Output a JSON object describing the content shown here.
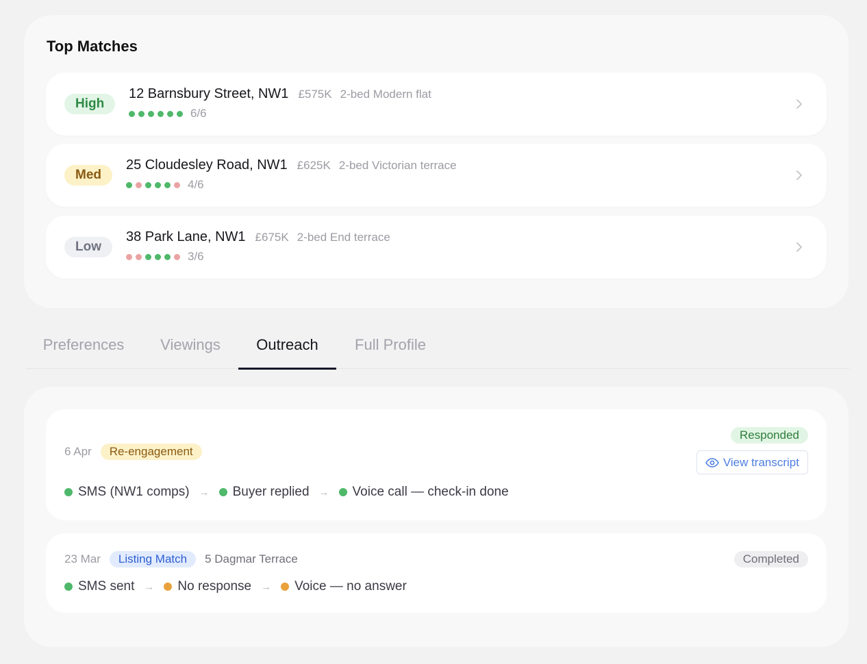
{
  "top_matches": {
    "title": "Top Matches",
    "items": [
      {
        "badge": "High",
        "address": "12 Barnsbury Street, NW1",
        "price": "£575K",
        "type": "2-bed Modern flat",
        "score": "6/6",
        "dots": [
          "green",
          "green",
          "green",
          "green",
          "green",
          "green"
        ]
      },
      {
        "badge": "Med",
        "address": "25 Cloudesley Road, NW1",
        "price": "£625K",
        "type": "2-bed Victorian terrace",
        "score": "4/6",
        "dots": [
          "green",
          "red",
          "green",
          "green",
          "green",
          "red"
        ]
      },
      {
        "badge": "Low",
        "address": "38 Park Lane, NW1",
        "price": "£675K",
        "type": "2-bed End terrace",
        "score": "3/6",
        "dots": [
          "red",
          "red",
          "green",
          "green",
          "green",
          "red"
        ]
      }
    ]
  },
  "tabs": [
    "Preferences",
    "Viewings",
    "Outreach",
    "Full Profile"
  ],
  "active_tab": "Outreach",
  "outreach": [
    {
      "date": "6 Apr",
      "tag": "Re-engagement",
      "status": "Responded",
      "action": "View transcript",
      "steps": [
        {
          "label": "SMS (NW1 comps)",
          "dot": "green"
        },
        {
          "label": "Buyer replied",
          "dot": "green"
        },
        {
          "label": "Voice call — check-in done",
          "dot": "green"
        }
      ]
    },
    {
      "date": "23 Mar",
      "tag": "Listing Match",
      "property": "5 Dagmar Terrace",
      "status": "Completed",
      "steps": [
        {
          "label": "SMS sent",
          "dot": "green"
        },
        {
          "label": "No response",
          "dot": "orange"
        },
        {
          "label": "Voice — no answer",
          "dot": "orange"
        }
      ]
    }
  ],
  "icons": {
    "chevron": "chevron-right-icon",
    "eye": "eye-icon",
    "arrow": "arrow-right-icon"
  },
  "colors": {
    "high_badge_bg": "#e2f5e6",
    "high_badge_text": "#2f8a45",
    "med_badge_bg": "#fcf1c7",
    "med_badge_text": "#8a5a12",
    "low_badge_bg": "#eef0f3",
    "low_badge_text": "#6f7380",
    "dot_green": "#4fb86a",
    "dot_red": "#eaa3a3",
    "accent_blue": "#4d7fe0"
  }
}
